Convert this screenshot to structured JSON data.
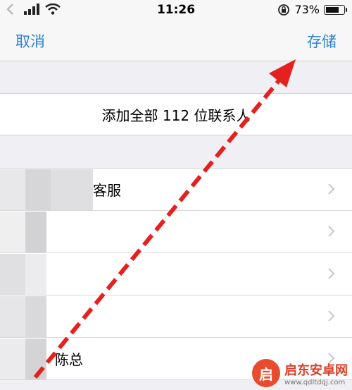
{
  "status_bar": {
    "carrier": "",
    "time": "11:26",
    "battery": "73%",
    "battery_level": 0.73
  },
  "nav": {
    "cancel": "取消",
    "save": "存储"
  },
  "add_all": "添加全部 112 位联系人",
  "contacts": [
    {
      "label": "客服"
    },
    {
      "label": ""
    },
    {
      "label": ""
    },
    {
      "label": ""
    },
    {
      "label": "陈总"
    }
  ],
  "watermark": {
    "logo": "启",
    "name": "启东安卓网",
    "url": "www.qdltdqj.com"
  },
  "colors": {
    "accent": "#2b7fd9",
    "arrow": "#e5201e",
    "background": "#efeff4"
  }
}
